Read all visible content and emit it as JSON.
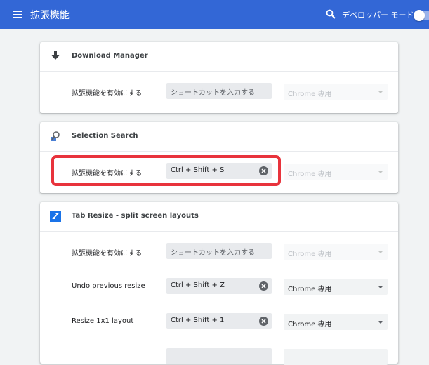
{
  "header": {
    "title": "拡張機能",
    "dev_mode_label": "デベロッパー モード",
    "dev_mode_on": false,
    "bar_color": "#3367d6"
  },
  "extensions": [
    {
      "name": "Download Manager",
      "icon": "download-arrow-icon",
      "rows": [
        {
          "label": "拡張機能を有効にする",
          "shortcut": "",
          "shortcut_placeholder": "ショートカットを入力する",
          "scope": "Chrome 専用",
          "scope_enabled": false
        }
      ]
    },
    {
      "name": "Selection Search",
      "icon": "magnifier-icon",
      "rows": [
        {
          "label": "拡張機能を有効にする",
          "shortcut": "Ctrl + Shift + S",
          "shortcut_placeholder": "",
          "scope": "Chrome 専用",
          "scope_enabled": false
        }
      ]
    },
    {
      "name": "Tab Resize - split screen layouts",
      "icon": "resize-arrow-icon",
      "rows": [
        {
          "label": "拡張機能を有効にする",
          "shortcut": "",
          "shortcut_placeholder": "ショートカットを入力する",
          "scope": "Chrome 専用",
          "scope_enabled": false
        },
        {
          "label": "Undo previous resize",
          "shortcut": "Ctrl + Shift + Z",
          "shortcut_placeholder": "",
          "scope": "Chrome 専用",
          "scope_enabled": true
        },
        {
          "label": "Resize 1x1 layout",
          "shortcut": "Ctrl + Shift + 1",
          "shortcut_placeholder": "",
          "scope": "Chrome 専用",
          "scope_enabled": true
        }
      ]
    }
  ],
  "annotation_color": "#e8333c"
}
